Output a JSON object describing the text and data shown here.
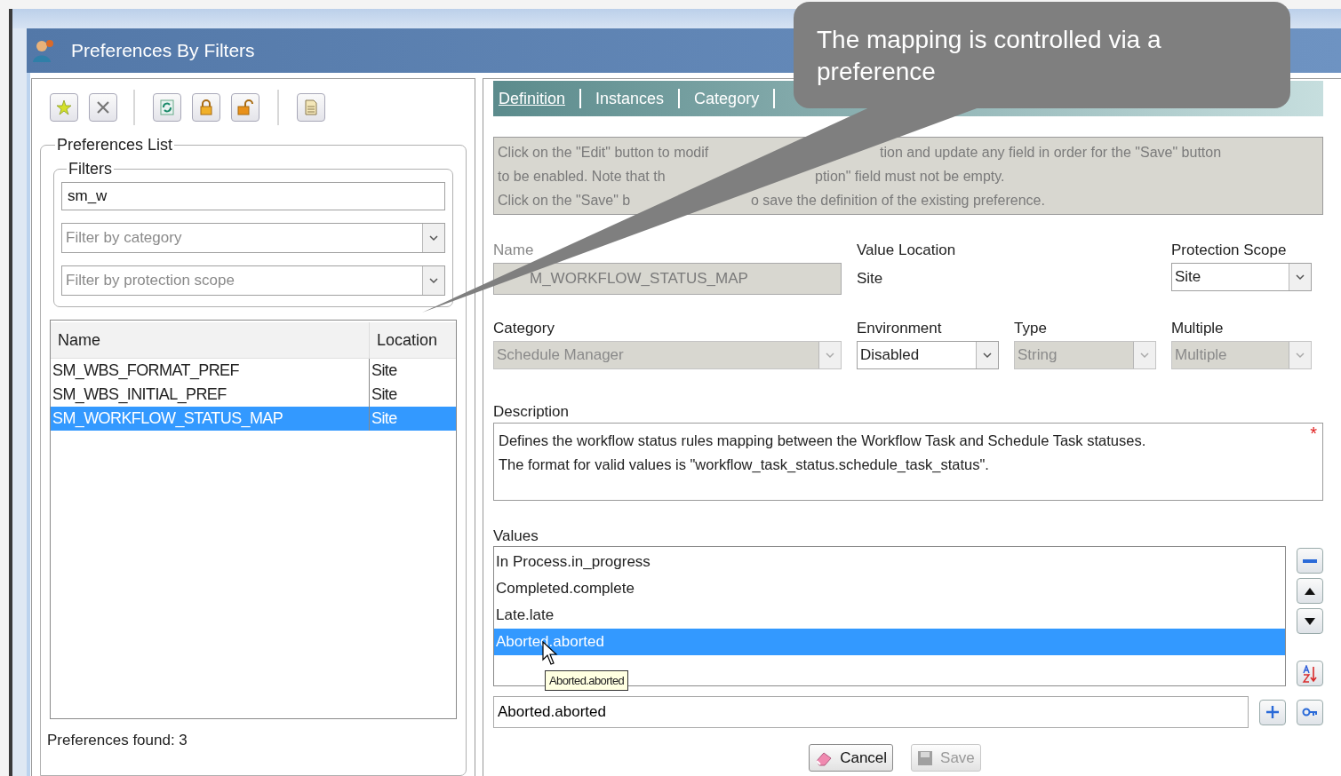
{
  "dialog": {
    "title": "Preferences By Filters"
  },
  "callout": {
    "text": "The mapping is controlled via a preference"
  },
  "preferences_list": {
    "title": "Preferences List",
    "filters": {
      "title": "Filters",
      "search": {
        "value": "sm_w"
      },
      "dropdowns": [
        {
          "placeholder": "Filter by category"
        },
        {
          "placeholder": "Filter by protection scope"
        }
      ]
    },
    "table": {
      "columns": [
        "Name",
        "Location"
      ],
      "rows": [
        {
          "name": "SM_WBS_FORMAT_PREF",
          "location": "Site",
          "selected": false
        },
        {
          "name": "SM_WBS_INITIAL_PREF",
          "location": "Site",
          "selected": false
        },
        {
          "name": "SM_WORKFLOW_STATUS_MAP",
          "location": "Site",
          "selected": true
        }
      ]
    },
    "footer": "Preferences found: 3"
  },
  "tabs": [
    {
      "label": "Definition",
      "selected": true
    },
    {
      "label": "Instances",
      "selected": false
    },
    {
      "label": "Category",
      "selected": false
    }
  ],
  "info": {
    "lines": [
      [
        "Click on the \"Edit\" button to modif",
        "tion and update any field in order for the \"Save\" button"
      ],
      [
        "to be enabled. Note that th",
        "ption\" field must not be empty."
      ],
      [
        "Click on the \"Save\" b",
        "o save the definition of the existing preference."
      ]
    ]
  },
  "form": {
    "rows": [
      [
        {
          "kind": "text",
          "label": "Name",
          "value": "M_WORKFLOW_STATUS_MAP",
          "disabled": true
        },
        {
          "kind": "plain",
          "label": "Value Location",
          "value": "Site"
        },
        "",
        {
          "kind": "dropdown",
          "label": "Protection Scope",
          "value": "Site",
          "disabled": false
        }
      ],
      [
        {
          "kind": "dropdown",
          "label": "Category",
          "value": "Schedule Manager",
          "disabled": true
        },
        {
          "kind": "dropdown",
          "label": "Environment",
          "value": "Disabled",
          "disabled": false
        },
        {
          "kind": "dropdown",
          "label": "Type",
          "value": "String",
          "disabled": true
        },
        {
          "kind": "dropdown",
          "label": "Multiple",
          "value": "Multiple",
          "disabled": true
        }
      ]
    ]
  },
  "description": {
    "label": "Description",
    "required_mark": "*",
    "text": "Defines the workflow status rules mapping between the Workflow Task and Schedule Task statuses.\nThe format for valid values is \"workflow_task_status.schedule_task_status\"."
  },
  "values": {
    "label": "Values",
    "items": [
      {
        "text": "In Process.in_progress",
        "selected": false
      },
      {
        "text": "Completed.complete",
        "selected": false
      },
      {
        "text": "Late.late",
        "selected": false
      },
      {
        "text": "Aborted.aborted",
        "selected": true
      }
    ],
    "tooltip": "Aborted.aborted",
    "input": {
      "value": "Aborted.aborted"
    }
  },
  "buttons": [
    {
      "label": "Cancel",
      "kind": "cancel",
      "disabled": false
    },
    {
      "label": "Save",
      "kind": "save",
      "disabled": true
    }
  ]
}
